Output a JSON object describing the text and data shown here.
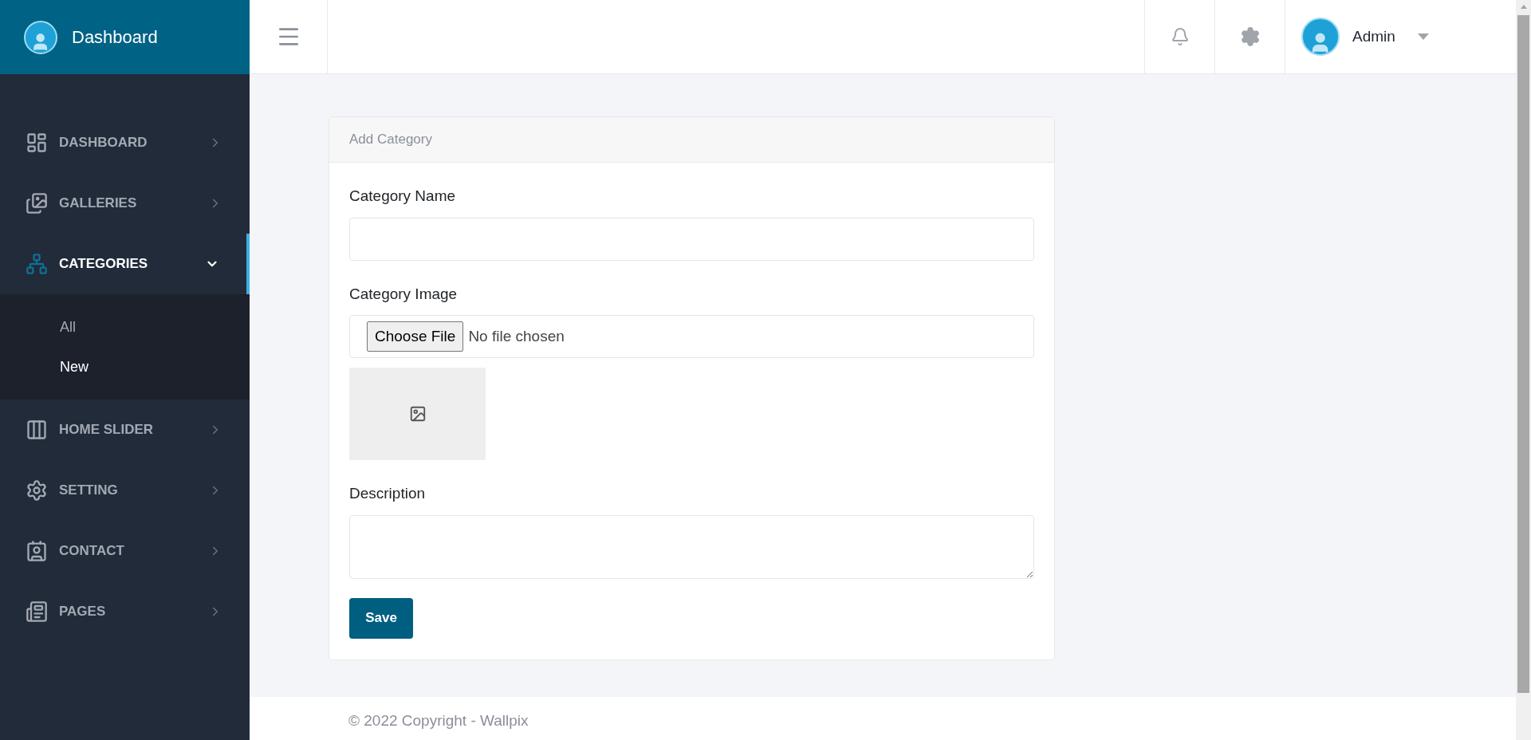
{
  "brand": {
    "title": "Dashboard"
  },
  "sidebar": {
    "items": [
      {
        "label": "DASHBOARD",
        "selected": false,
        "expanded": false
      },
      {
        "label": "GALLERIES",
        "selected": false,
        "expanded": false
      },
      {
        "label": "CATEGORIES",
        "selected": true,
        "expanded": true,
        "children": [
          {
            "label": "All",
            "selected": false
          },
          {
            "label": "New",
            "selected": true
          }
        ]
      },
      {
        "label": "HOME SLIDER",
        "selected": false,
        "expanded": false
      },
      {
        "label": "SETTING",
        "selected": false,
        "expanded": false
      },
      {
        "label": "CONTACT",
        "selected": false,
        "expanded": false
      },
      {
        "label": "PAGES",
        "selected": false,
        "expanded": false
      }
    ]
  },
  "topbar": {
    "user": {
      "name": "Admin"
    }
  },
  "card": {
    "title": "Add Category",
    "fields": [
      {
        "kind": "text",
        "label": "Category Name"
      },
      {
        "kind": "file",
        "label": "Category Image",
        "button": "Choose File",
        "status": "No file chosen"
      },
      {
        "kind": "textarea",
        "label": "Description"
      }
    ],
    "save_button": "Save"
  },
  "footer": {
    "text": "© 2022 Copyright - Wallpix"
  }
}
